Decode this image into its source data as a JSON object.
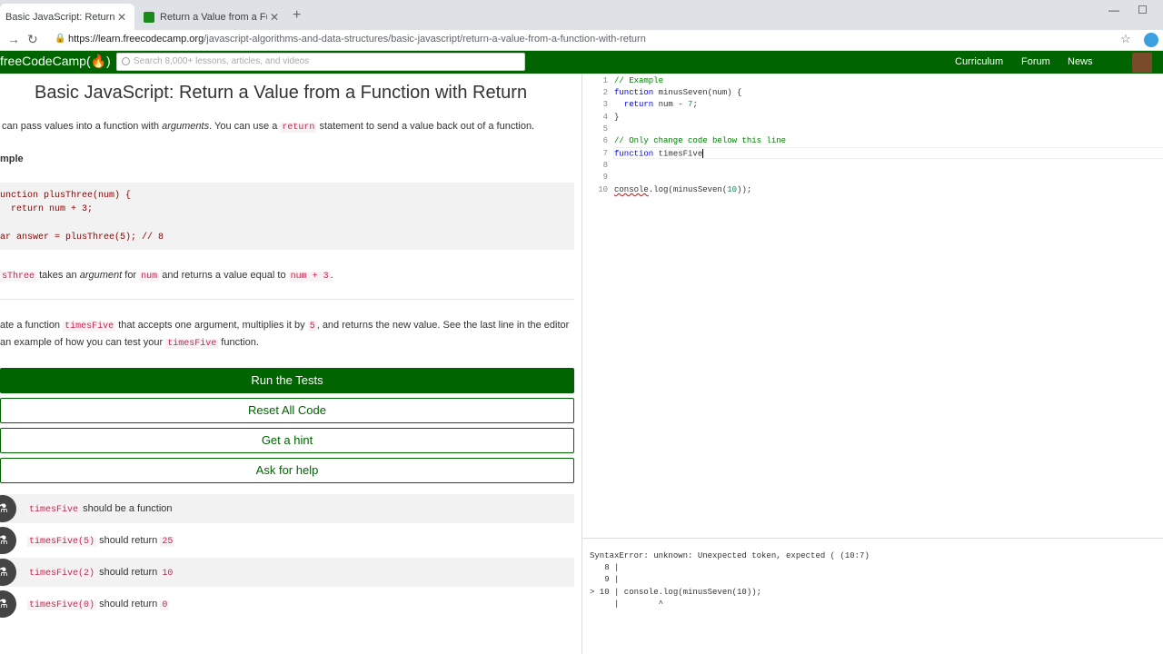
{
  "browser": {
    "tabs": [
      {
        "label": "Basic JavaScript: Return a Value f",
        "active": true
      },
      {
        "label": "Return a Value from a Function w",
        "active": false
      }
    ],
    "url_host": "https://learn.freecodecamp.org",
    "url_path": "/javascript-algorithms-and-data-structures/basic-javascript/return-a-value-from-a-function-with-return"
  },
  "nav": {
    "logo": "freeCodeCamp(🔥)",
    "search_placeholder": "Search 8,000+ lessons, articles, and videos",
    "links": [
      "Curriculum",
      "Forum",
      "News"
    ]
  },
  "lesson": {
    "title": "Basic JavaScript: Return a Value from a Function with Return",
    "intro_a": "can pass values into a function with ",
    "intro_em": "arguments",
    "intro_b": ". You can use a ",
    "intro_code": "return",
    "intro_c": " statement to send a value back out of a function.",
    "example_label": "mple",
    "example_code": [
      "unction plusThree(num) {",
      "  return num + 3;",
      "",
      "ar answer = plusThree(5); // 8"
    ],
    "explain_code1": "sThree",
    "explain_a": " takes an ",
    "explain_em": "argument",
    "explain_b": " for ",
    "explain_code2": "num",
    "explain_c": " and returns a value equal to ",
    "explain_code3": "num + 3",
    "explain_d": ".",
    "task_a": "ate a function ",
    "task_code1": "timesFive",
    "task_b": " that accepts one argument, multiplies it by ",
    "task_code2": "5",
    "task_c": ", and returns the new value. See the last line in the editor",
    "task2_a": "an example of how you can test your ",
    "task2_code": "timesFive",
    "task2_b": " function."
  },
  "buttons": {
    "run": "Run the Tests",
    "reset": "Reset All Code",
    "hint": "Get a hint",
    "help": "Ask for help"
  },
  "tests": [
    {
      "code": "timesFive",
      "text": " should be a function",
      "value": ""
    },
    {
      "code": "timesFive(5)",
      "text": " should return ",
      "value": "25"
    },
    {
      "code": "timesFive(2)",
      "text": " should return ",
      "value": "10"
    },
    {
      "code": "timesFive(0)",
      "text": " should return ",
      "value": "0"
    }
  ],
  "editor": {
    "line_numbers": [
      "1",
      "2",
      "3",
      "4",
      "5",
      "6",
      "7",
      "8",
      "9",
      "10"
    ],
    "l1": "// Example",
    "l2_kw": "function",
    "l2_rest": " minusSeven(num) {",
    "l3_kw": "  return",
    "l3_a": " num - ",
    "l3_num": "7",
    "l3_b": ";",
    "l4": "}",
    "l6": "// Only change code below this line",
    "l7_kw": "function",
    "l7_rest": " timesFive",
    "l10_err": "console",
    "l10_a": ".log(minusSeven(",
    "l10_num": "10",
    "l10_b": "));"
  },
  "console": {
    "lines": [
      "SyntaxError: unknown: Unexpected token, expected ( (10:7)",
      "   8 |",
      "   9 |",
      "> 10 | console.log(minusSeven(10));",
      "     |        ^"
    ]
  }
}
